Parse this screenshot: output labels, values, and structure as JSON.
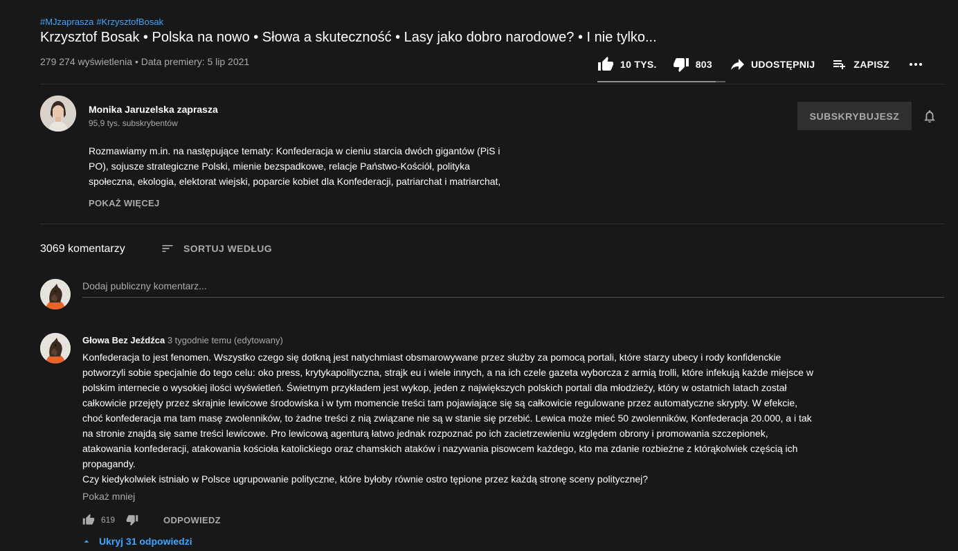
{
  "video": {
    "hashtags": [
      "#MJzaprasza",
      "#KrzysztofBosak"
    ],
    "title": "Krzysztof Bosak • Polska na nowo • Słowa a skuteczność • Lasy jako dobro narodowe? • I nie tylko...",
    "views": "279 274 wyświetlenia",
    "separator": " • ",
    "premiere": "Data premiery: 5 lip 2021",
    "likes": "10 TYS.",
    "dislikes": "803",
    "share_label": "UDOSTĘPNIJ",
    "save_label": "ZAPISZ",
    "like_ratio": 0.925
  },
  "channel": {
    "name": "Monika Jaruzelska zaprasza",
    "subscribers": "95,9 tys. subskrybentów",
    "subscribe_label": "SUBSKRYBUJESZ"
  },
  "description": {
    "lines": [
      "Rozmawiamy m.in. na następujące tematy: Konfederacja w cieniu starcia dwóch gigantów (PiS i",
      "PO), sojusze strategiczne Polski, mienie bezspadkowe, relacje Państwo-Kościół, polityka",
      "społeczna, ekologia, elektorat wiejski, poparcie kobiet dla Konfederacji, patriarchat i matriarchat,"
    ],
    "show_more_label": "POKAŻ WIĘCEJ"
  },
  "comments": {
    "count": "3069 komentarzy",
    "sort_label": "SORTUJ WEDŁUG",
    "add_placeholder": "Dodaj publiczny komentarz..."
  },
  "comment": {
    "author": "Głowa Bez Jeźdźca",
    "time": "3 tygodnie temu (edytowany)",
    "lines": [
      "Konfederacja to jest fenomen. Wszystko czego się dotkną jest natychmiast obsmarowywane przez służby za pomocą portali, które starzy ubecy i rody konfidenckie",
      "potworzyli sobie specjalnie do tego celu: oko press, krytykapolityczna, strajk eu i wiele innych, a na ich czele gazeta wyborcza z armią trolli, które infekują każde miejsce w",
      "polskim internecie o wysokiej ilości wyświetleń. Świetnym przykładem jest wykop, jeden z największych polskich portali dla młodzieży, który w ostatnich latach został",
      "całkowicie przejęty przez skrajnie lewicowe środowiska i w tym momencie treści tam pojawiające się są całkowicie regulowane przez automatyczne skrypty. W efekcie,",
      "choć konfederacja ma tam masę zwolenników, to żadne treści z nią związane nie są w stanie się przebić. Lewica może mieć 50 zwolenników, Konfederacja 20.000, a i tak",
      "na stronie znajdą się same treści lewicowe. Pro lewicową agenturą łatwo jednak rozpoznać po ich zacietrzewieniu względem obrony i promowania szczepionek,",
      "atakowania konfederacji, atakowania kościoła katolickiego oraz chamskich ataków i nazywania pisowcem każdego, kto ma zdanie rozbieżne z którąkolwiek częścią ich",
      "propagandy.",
      "Czy kiedykolwiek istniało w Polsce ugrupowanie polityczne, które byłoby równie ostro tępione przez każdą stronę sceny politycznej?"
    ],
    "show_less_label": "Pokaż mniej",
    "likes": "619",
    "reply_label": "ODPOWIEDZ",
    "hide_replies_label": "Ukryj 31 odpowiedzi"
  }
}
